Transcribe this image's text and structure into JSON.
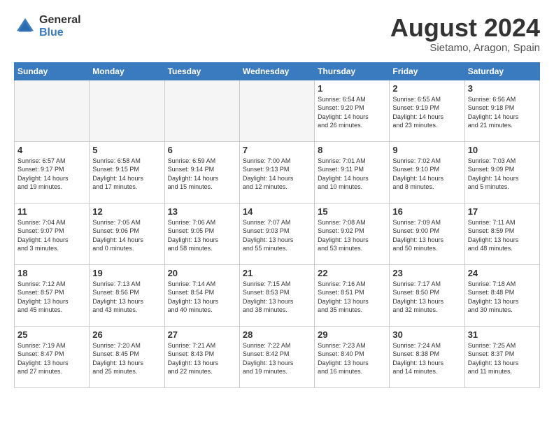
{
  "logo": {
    "general": "General",
    "blue": "Blue"
  },
  "title": "August 2024",
  "location": "Sietamo, Aragon, Spain",
  "days_of_week": [
    "Sunday",
    "Monday",
    "Tuesday",
    "Wednesday",
    "Thursday",
    "Friday",
    "Saturday"
  ],
  "weeks": [
    [
      {
        "day": "",
        "info": "",
        "empty": true
      },
      {
        "day": "",
        "info": "",
        "empty": true
      },
      {
        "day": "",
        "info": "",
        "empty": true
      },
      {
        "day": "",
        "info": "",
        "empty": true
      },
      {
        "day": "1",
        "info": "Sunrise: 6:54 AM\nSunset: 9:20 PM\nDaylight: 14 hours\nand 26 minutes."
      },
      {
        "day": "2",
        "info": "Sunrise: 6:55 AM\nSunset: 9:19 PM\nDaylight: 14 hours\nand 23 minutes."
      },
      {
        "day": "3",
        "info": "Sunrise: 6:56 AM\nSunset: 9:18 PM\nDaylight: 14 hours\nand 21 minutes."
      }
    ],
    [
      {
        "day": "4",
        "info": "Sunrise: 6:57 AM\nSunset: 9:17 PM\nDaylight: 14 hours\nand 19 minutes."
      },
      {
        "day": "5",
        "info": "Sunrise: 6:58 AM\nSunset: 9:15 PM\nDaylight: 14 hours\nand 17 minutes."
      },
      {
        "day": "6",
        "info": "Sunrise: 6:59 AM\nSunset: 9:14 PM\nDaylight: 14 hours\nand 15 minutes."
      },
      {
        "day": "7",
        "info": "Sunrise: 7:00 AM\nSunset: 9:13 PM\nDaylight: 14 hours\nand 12 minutes."
      },
      {
        "day": "8",
        "info": "Sunrise: 7:01 AM\nSunset: 9:11 PM\nDaylight: 14 hours\nand 10 minutes."
      },
      {
        "day": "9",
        "info": "Sunrise: 7:02 AM\nSunset: 9:10 PM\nDaylight: 14 hours\nand 8 minutes."
      },
      {
        "day": "10",
        "info": "Sunrise: 7:03 AM\nSunset: 9:09 PM\nDaylight: 14 hours\nand 5 minutes."
      }
    ],
    [
      {
        "day": "11",
        "info": "Sunrise: 7:04 AM\nSunset: 9:07 PM\nDaylight: 14 hours\nand 3 minutes."
      },
      {
        "day": "12",
        "info": "Sunrise: 7:05 AM\nSunset: 9:06 PM\nDaylight: 14 hours\nand 0 minutes."
      },
      {
        "day": "13",
        "info": "Sunrise: 7:06 AM\nSunset: 9:05 PM\nDaylight: 13 hours\nand 58 minutes."
      },
      {
        "day": "14",
        "info": "Sunrise: 7:07 AM\nSunset: 9:03 PM\nDaylight: 13 hours\nand 55 minutes."
      },
      {
        "day": "15",
        "info": "Sunrise: 7:08 AM\nSunset: 9:02 PM\nDaylight: 13 hours\nand 53 minutes."
      },
      {
        "day": "16",
        "info": "Sunrise: 7:09 AM\nSunset: 9:00 PM\nDaylight: 13 hours\nand 50 minutes."
      },
      {
        "day": "17",
        "info": "Sunrise: 7:11 AM\nSunset: 8:59 PM\nDaylight: 13 hours\nand 48 minutes."
      }
    ],
    [
      {
        "day": "18",
        "info": "Sunrise: 7:12 AM\nSunset: 8:57 PM\nDaylight: 13 hours\nand 45 minutes."
      },
      {
        "day": "19",
        "info": "Sunrise: 7:13 AM\nSunset: 8:56 PM\nDaylight: 13 hours\nand 43 minutes."
      },
      {
        "day": "20",
        "info": "Sunrise: 7:14 AM\nSunset: 8:54 PM\nDaylight: 13 hours\nand 40 minutes."
      },
      {
        "day": "21",
        "info": "Sunrise: 7:15 AM\nSunset: 8:53 PM\nDaylight: 13 hours\nand 38 minutes."
      },
      {
        "day": "22",
        "info": "Sunrise: 7:16 AM\nSunset: 8:51 PM\nDaylight: 13 hours\nand 35 minutes."
      },
      {
        "day": "23",
        "info": "Sunrise: 7:17 AM\nSunset: 8:50 PM\nDaylight: 13 hours\nand 32 minutes."
      },
      {
        "day": "24",
        "info": "Sunrise: 7:18 AM\nSunset: 8:48 PM\nDaylight: 13 hours\nand 30 minutes."
      }
    ],
    [
      {
        "day": "25",
        "info": "Sunrise: 7:19 AM\nSunset: 8:47 PM\nDaylight: 13 hours\nand 27 minutes."
      },
      {
        "day": "26",
        "info": "Sunrise: 7:20 AM\nSunset: 8:45 PM\nDaylight: 13 hours\nand 25 minutes."
      },
      {
        "day": "27",
        "info": "Sunrise: 7:21 AM\nSunset: 8:43 PM\nDaylight: 13 hours\nand 22 minutes."
      },
      {
        "day": "28",
        "info": "Sunrise: 7:22 AM\nSunset: 8:42 PM\nDaylight: 13 hours\nand 19 minutes."
      },
      {
        "day": "29",
        "info": "Sunrise: 7:23 AM\nSunset: 8:40 PM\nDaylight: 13 hours\nand 16 minutes."
      },
      {
        "day": "30",
        "info": "Sunrise: 7:24 AM\nSunset: 8:38 PM\nDaylight: 13 hours\nand 14 minutes."
      },
      {
        "day": "31",
        "info": "Sunrise: 7:25 AM\nSunset: 8:37 PM\nDaylight: 13 hours\nand 11 minutes."
      }
    ]
  ]
}
